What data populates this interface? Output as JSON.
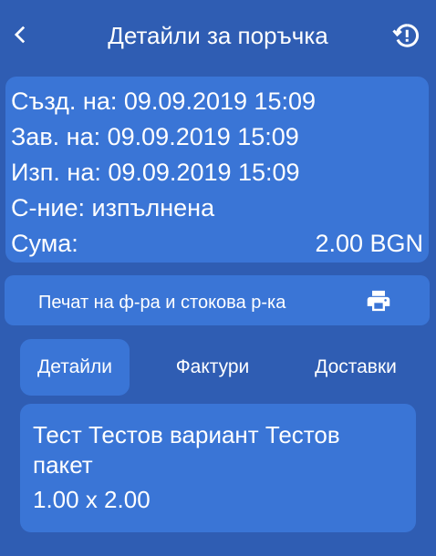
{
  "header": {
    "title": "Детайли за поръчка",
    "back_icon": "chevron-left-icon",
    "history_icon": "history-alert-icon"
  },
  "order_info": {
    "created": {
      "label": "Създ. на:",
      "value": "09.09.2019 15:09"
    },
    "completed": {
      "label": "Зав. на:",
      "value": "09.09.2019 15:09"
    },
    "executed": {
      "label": "Изп. на:",
      "value": "09.09.2019 15:09"
    },
    "status": {
      "label": "С-ние:",
      "value": "изпълнена"
    },
    "amount": {
      "label": "Сума:",
      "value": "2.00 BGN"
    }
  },
  "print_button": {
    "label": "Печат на ф-ра и стокова р-ка",
    "icon": "printer-icon"
  },
  "tabs": [
    {
      "label": "Детайли",
      "active": true
    },
    {
      "label": "Фактури",
      "active": false
    },
    {
      "label": "Доставки",
      "active": false
    }
  ],
  "items": [
    {
      "name": "Тест Тестов вариант Тестов пакет",
      "quantity_line": "1.00 x 2.00"
    }
  ],
  "colors": {
    "background": "#2f5db3",
    "card": "#3a75d6",
    "text": "#ffffff"
  }
}
